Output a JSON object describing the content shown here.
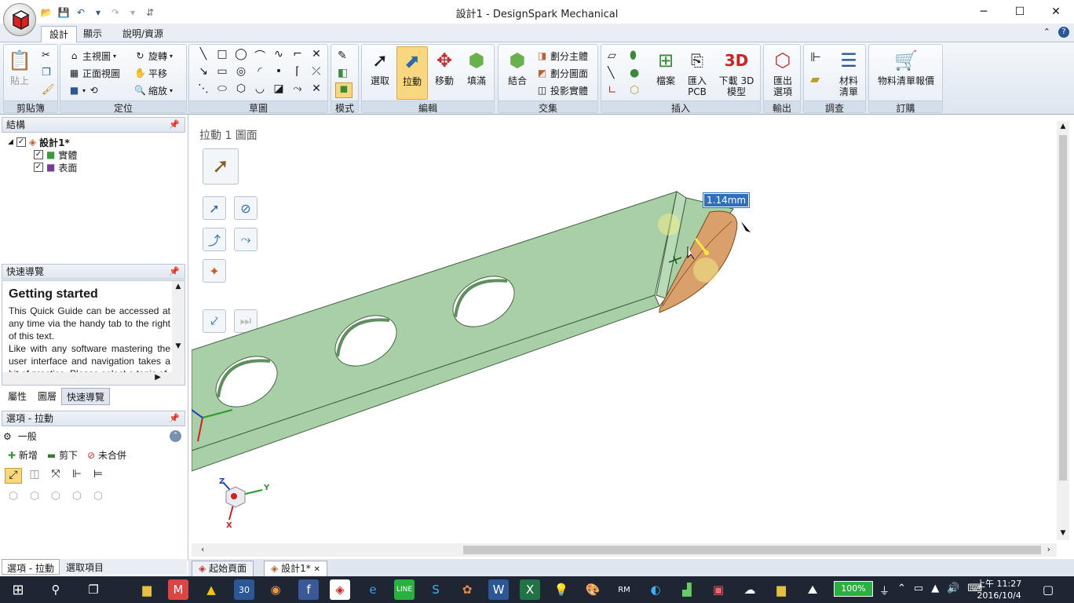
{
  "window": {
    "title": "設計1 - DesignSpark Mechanical",
    "minimize": "─",
    "maximize": "☐",
    "close": "✕"
  },
  "qat": [
    "📂",
    "💾",
    "↶",
    "▾",
    "↷",
    "▾",
    "⇵"
  ],
  "tabs": [
    "設計",
    "顯示",
    "說明/資源"
  ],
  "ribbon": {
    "clipboard": {
      "paste": "貼上",
      "label": "剪貼簿"
    },
    "orient": {
      "home": "主視圖",
      "front": "正面視圖",
      "rotate": "旋轉",
      "pan": "平移",
      "zoom": "縮放",
      "label": "定位"
    },
    "sketch": {
      "label": "草圖"
    },
    "mode": {
      "label": "模式"
    },
    "edit": {
      "select": "選取",
      "pull": "拉動",
      "move": "移動",
      "fill": "填滿",
      "label": "編輯"
    },
    "intersect": {
      "combine": "結合",
      "split_body": "劃分主體",
      "split_face": "劃分圖面",
      "project": "投影實體",
      "label": "交集"
    },
    "insert": {
      "file": "檔案",
      "pcb": "匯入\nPCB",
      "download": "下載 3D\n模型",
      "label": "插入"
    },
    "output": {
      "export": "匯出\n選項",
      "label": "輸出"
    },
    "investigate": {
      "bom": "材料\n清單",
      "label": "調查"
    },
    "order": {
      "quote": "物料清單報價",
      "label": "訂購"
    }
  },
  "structure": {
    "title": "結構",
    "root": "設計1*",
    "items": [
      "實體",
      "表面"
    ]
  },
  "quickguide": {
    "title": "快速導覽",
    "heading": "Getting started",
    "p1": "This Quick Guide can be accessed at any time via the handy tab to the right of this text.",
    "p2": "Like with any software mastering the user interface and navigation takes a bit of practice. Please select a topic of",
    "tabs": [
      "屬性",
      "圖層",
      "快速導覽"
    ]
  },
  "options": {
    "title": "選項 - 拉動",
    "section": "一般",
    "add": "新增",
    "cut": "剪下",
    "nomerge": "未合併"
  },
  "bottomtabs": [
    "選項 - 拉動",
    "選取項目"
  ],
  "viewport": {
    "title": "拉動 1 圖面",
    "dimension": "1.14mm",
    "axes": {
      "x": "X",
      "y": "Y",
      "z": "Z"
    }
  },
  "doctabs": [
    "起始頁面",
    "設計1*"
  ],
  "taskbar": {
    "battery": "100%",
    "time": "上午 11:27",
    "date": "2016/10/4",
    "calendar": "30"
  },
  "colors": {
    "body": "#a8cfa5",
    "face_selected": "#d9a06c",
    "ribbon_active": "#f9d77e"
  }
}
